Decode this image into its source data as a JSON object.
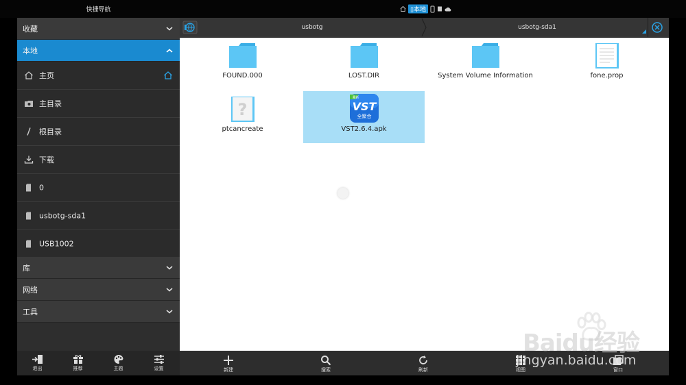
{
  "top": {
    "nav_title": "快捷导航",
    "status_selected": "本地"
  },
  "sidebar": {
    "favorites_label": "收藏",
    "local_label": "本地",
    "items": [
      {
        "label": "主页",
        "icon": "home-icon"
      },
      {
        "label": "主目录",
        "icon": "folder-camera-icon"
      },
      {
        "label": "根目录",
        "icon": "slash-icon"
      },
      {
        "label": "下载",
        "icon": "download-icon"
      },
      {
        "label": "0",
        "icon": "sd-card-icon"
      },
      {
        "label": "usbotg-sda1",
        "icon": "sd-card-icon"
      },
      {
        "label": "USB1002",
        "icon": "sd-card-icon"
      }
    ],
    "library_label": "库",
    "network_label": "网络",
    "tools_label": "工具"
  },
  "sidebar_toolbar": {
    "exit": "退出",
    "recommend": "推荐",
    "theme": "主题",
    "settings": "设置"
  },
  "path": {
    "crumb1": "usbotg",
    "crumb2": "usbotg-sda1"
  },
  "files": [
    {
      "name": "FOUND.000",
      "type": "folder"
    },
    {
      "name": "LOST.DIR",
      "type": "folder"
    },
    {
      "name": "System Volume Information",
      "type": "folder"
    },
    {
      "name": "fone.prop",
      "type": "text-file"
    },
    {
      "name": "ptcancreate",
      "type": "unknown-file"
    },
    {
      "name": "VST2.6.4.apk",
      "type": "apk",
      "selected": true
    }
  ],
  "apk_icon_text": "VST",
  "apk_icon_sub": "全聚合",
  "apk_icon_badge": "最新",
  "main_toolbar": {
    "new": "新建",
    "search": "搜索",
    "refresh": "刷新",
    "view": "视图",
    "window": "窗口"
  },
  "watermark": {
    "brand": "Baidu经验",
    "url": "jingyan.baidu.com"
  },
  "colors": {
    "accent": "#1a8ad0",
    "folder": "#4fc3f7",
    "selection": "#a8def7"
  }
}
